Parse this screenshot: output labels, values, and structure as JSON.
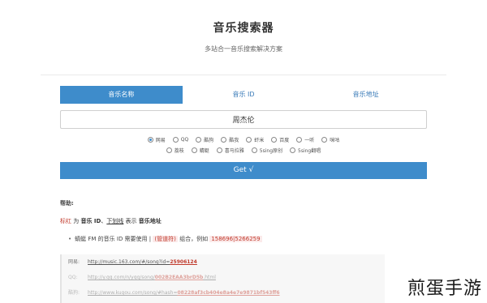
{
  "header": {
    "title": "音乐搜索器",
    "subtitle": "多站合一音乐搜索解决方案"
  },
  "tabs": [
    {
      "label": "音乐名称",
      "active": true
    },
    {
      "label": "音乐 ID",
      "active": false
    },
    {
      "label": "音乐地址",
      "active": false
    }
  ],
  "search": {
    "value": "周杰伦"
  },
  "sources": {
    "row1": [
      "网易",
      "QQ",
      "酷狗",
      "酷我",
      "虾米",
      "百度",
      "一听",
      "咪咕"
    ],
    "row2": [
      "荔枝",
      "蜻蜓",
      "喜马拉雅",
      "5sing原创",
      "5sing翻唱"
    ],
    "selected": "网易"
  },
  "get_button": {
    "label": "Get √"
  },
  "help": {
    "title": "帮助:",
    "legend": {
      "red_word": "标红",
      "t1": " 为 ",
      "music_id": "音乐 ID",
      "t2": "、",
      "underline_word": "下划线",
      "t3": " 表示 ",
      "music_url": "音乐地址"
    },
    "bullet": {
      "text1": "蜻蜓 FM 的音乐 ID 需要使用 ",
      "sep": "|",
      "tag": "(管道符)",
      "text2": " 组合，例如 ",
      "example": "158696|5266259"
    }
  },
  "examples": [
    {
      "label": "网易:",
      "url_prefix": "http://music.163.com/#/song?id=",
      "id": "25906124",
      "faded": false
    },
    {
      "label": "QQ:",
      "url_prefix": "http://y.qq.com/n/yqq/song/",
      "id": "002B2EAA3brD5b",
      "url_suffix": ".html",
      "faded": true
    },
    {
      "label": "酷狗:",
      "url_prefix": "http://www.kugou.com/song/#hash=",
      "id": "08228af3cb404e8a4e7e9871bf543ff6",
      "faded": true
    }
  ],
  "watermark": "煎蛋手游",
  "colors": {
    "accent": "#3e8ccb",
    "red": "#c0392b"
  }
}
